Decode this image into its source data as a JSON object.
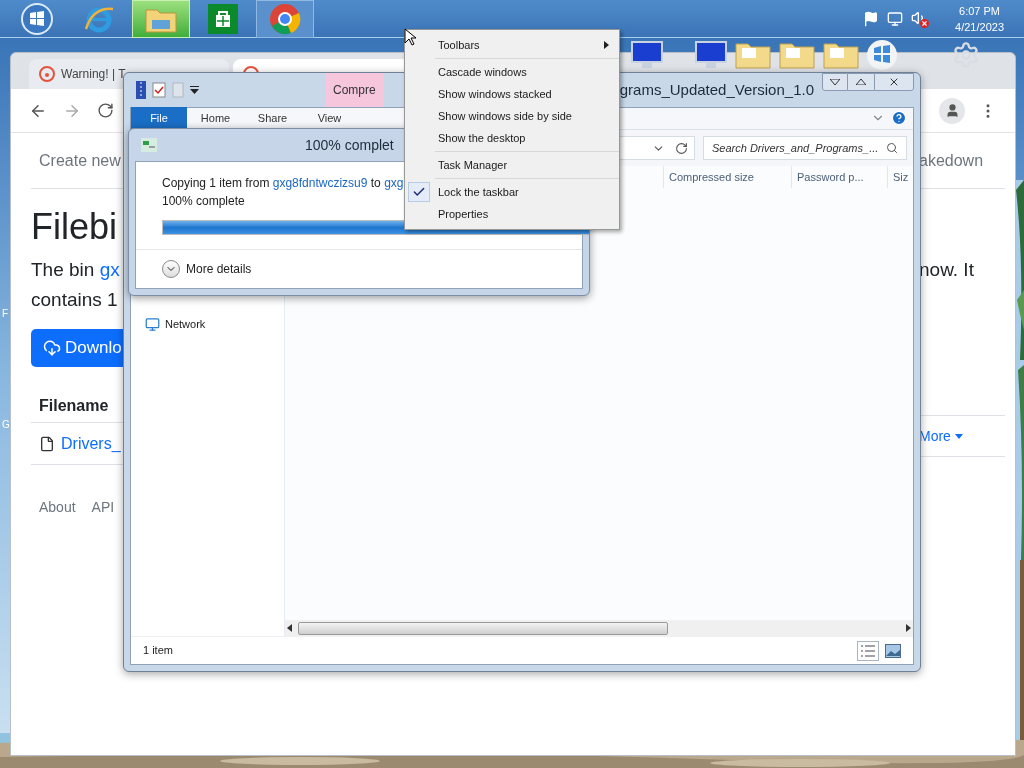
{
  "taskbar": {
    "apps": [
      {
        "kind": "start",
        "selected": false
      },
      {
        "kind": "browser-e",
        "selected": false
      },
      {
        "kind": "explorer",
        "selected": true
      },
      {
        "kind": "store",
        "selected": false
      },
      {
        "kind": "chrome",
        "selected": false
      }
    ],
    "tray": {
      "volume_muted": true
    },
    "clock": {
      "time": "6:07 PM",
      "date": "4/21/2023"
    }
  },
  "desktop_labels": [
    "F",
    "G"
  ],
  "browser": {
    "tabs": [
      {
        "title": "Warning! | T",
        "selected": false
      },
      {
        "selected": true
      }
    ],
    "nav_link": "Create new",
    "right_link": "akedown",
    "heading": "Filebi",
    "intro_start": "The bin",
    "intro_link": "gx",
    "intro_end": "now. It",
    "intro_line2": "contains 1",
    "download_button": "Downlo",
    "table": {
      "column": "Filename",
      "file_link": "Drivers_",
      "more": "More"
    },
    "footer_links": [
      "About",
      "API"
    ]
  },
  "explorer": {
    "title": "grams_Updated_Version_1.0",
    "contextual_tab": "Compre",
    "ribbon_tabs": [
      {
        "label": "File",
        "selected": true
      },
      {
        "label": "Home",
        "selected": false
      },
      {
        "label": "Share",
        "selected": false
      },
      {
        "label": "View",
        "selected": false
      }
    ],
    "search": {
      "placeholder": "Search Drivers_and_Programs_..."
    },
    "columns": [
      "Compressed size",
      "Password p...",
      "Siz"
    ],
    "nav": [
      {
        "label": "Network"
      }
    ],
    "status": "1 item"
  },
  "copy_dialog": {
    "title": "100% complet",
    "line_start": "Copying 1 item from",
    "source": "gxg8fdntwczizsu9",
    "to": "to",
    "dest": "gxg",
    "progress_text": "100% complete",
    "level": 1,
    "details": "More details"
  },
  "context_menu": {
    "groups": [
      [
        {
          "label": "Toolbars",
          "submenu": true,
          "checked": false
        }
      ],
      [
        {
          "label": "Cascade windows",
          "submenu": false,
          "checked": false
        },
        {
          "label": "Show windows stacked",
          "submenu": false,
          "checked": false
        },
        {
          "label": "Show windows side by side",
          "submenu": false,
          "checked": false
        },
        {
          "label": "Show the desktop",
          "submenu": false,
          "checked": false
        }
      ],
      [
        {
          "label": "Task Manager",
          "submenu": false,
          "checked": false
        }
      ],
      [
        {
          "label": "Lock the taskbar",
          "submenu": false,
          "checked": true
        },
        {
          "label": "Properties",
          "submenu": false,
          "checked": false
        }
      ]
    ]
  }
}
